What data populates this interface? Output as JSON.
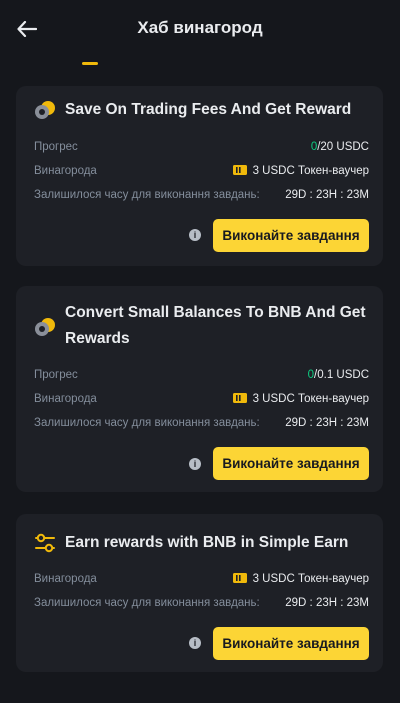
{
  "header": {
    "title": "Хаб винагород",
    "back_icon": "arrow-left-icon"
  },
  "colors": {
    "accent": "#fcd535",
    "progress_current": "#0ecb81",
    "card_bg": "#1e2026",
    "page_bg": "#15171c"
  },
  "cards": [
    {
      "icon": "coins-icon",
      "title": "Save On Trading Fees And Get Reward",
      "progress_label": "Прогрес",
      "progress_current": "0",
      "progress_rest": "/20 USDC",
      "reward_label": "Винагорода",
      "reward_value": "3 USDC Токен-ваучер",
      "time_label": "Залишилося часу для виконання завдань:",
      "time_value": "29D : 23H : 23M",
      "button_label": "Виконайте завдання"
    },
    {
      "icon": "coins-icon",
      "title": "Convert Small Balances To BNB And Get Rewards",
      "progress_label": "Прогрес",
      "progress_current": "0",
      "progress_rest": "/0.1 USDC",
      "reward_label": "Винагорода",
      "reward_value": "3 USDC Токен-ваучер",
      "time_label": "Залишилося часу для виконання завдань:",
      "time_value": "29D : 23H : 23M",
      "button_label": "Виконайте завдання"
    },
    {
      "icon": "sliders-icon",
      "title": "Earn rewards with BNB in Simple Earn",
      "reward_label": "Винагорода",
      "reward_value": "3 USDC Токен-ваучер",
      "time_label": "Залишилося часу для виконання завдань:",
      "time_value": "29D : 23H : 23M",
      "button_label": "Виконайте завдання"
    }
  ]
}
